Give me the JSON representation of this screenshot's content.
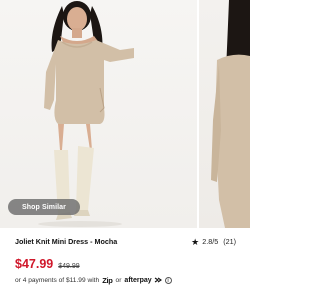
{
  "gallery": {
    "shop_similar_label": "Shop Similar"
  },
  "product": {
    "name": "Joliet Knit Mini Dress - Mocha",
    "rating_text": "2.8/5",
    "review_count": "(21)",
    "sale_price": "$47.99",
    "original_price": "$49.99"
  },
  "payment": {
    "prefix": "or 4 payments of $11.99 with",
    "zip_label": "Zip",
    "or_label": "or",
    "afterpay_label": "afterpay"
  },
  "icons": [
    "star-icon",
    "info-icon",
    "afterpay-arrows-icon"
  ],
  "colors": {
    "sale_price": "#d0172a",
    "dress": "#d2bfa7",
    "boots": "#ece5d3"
  }
}
